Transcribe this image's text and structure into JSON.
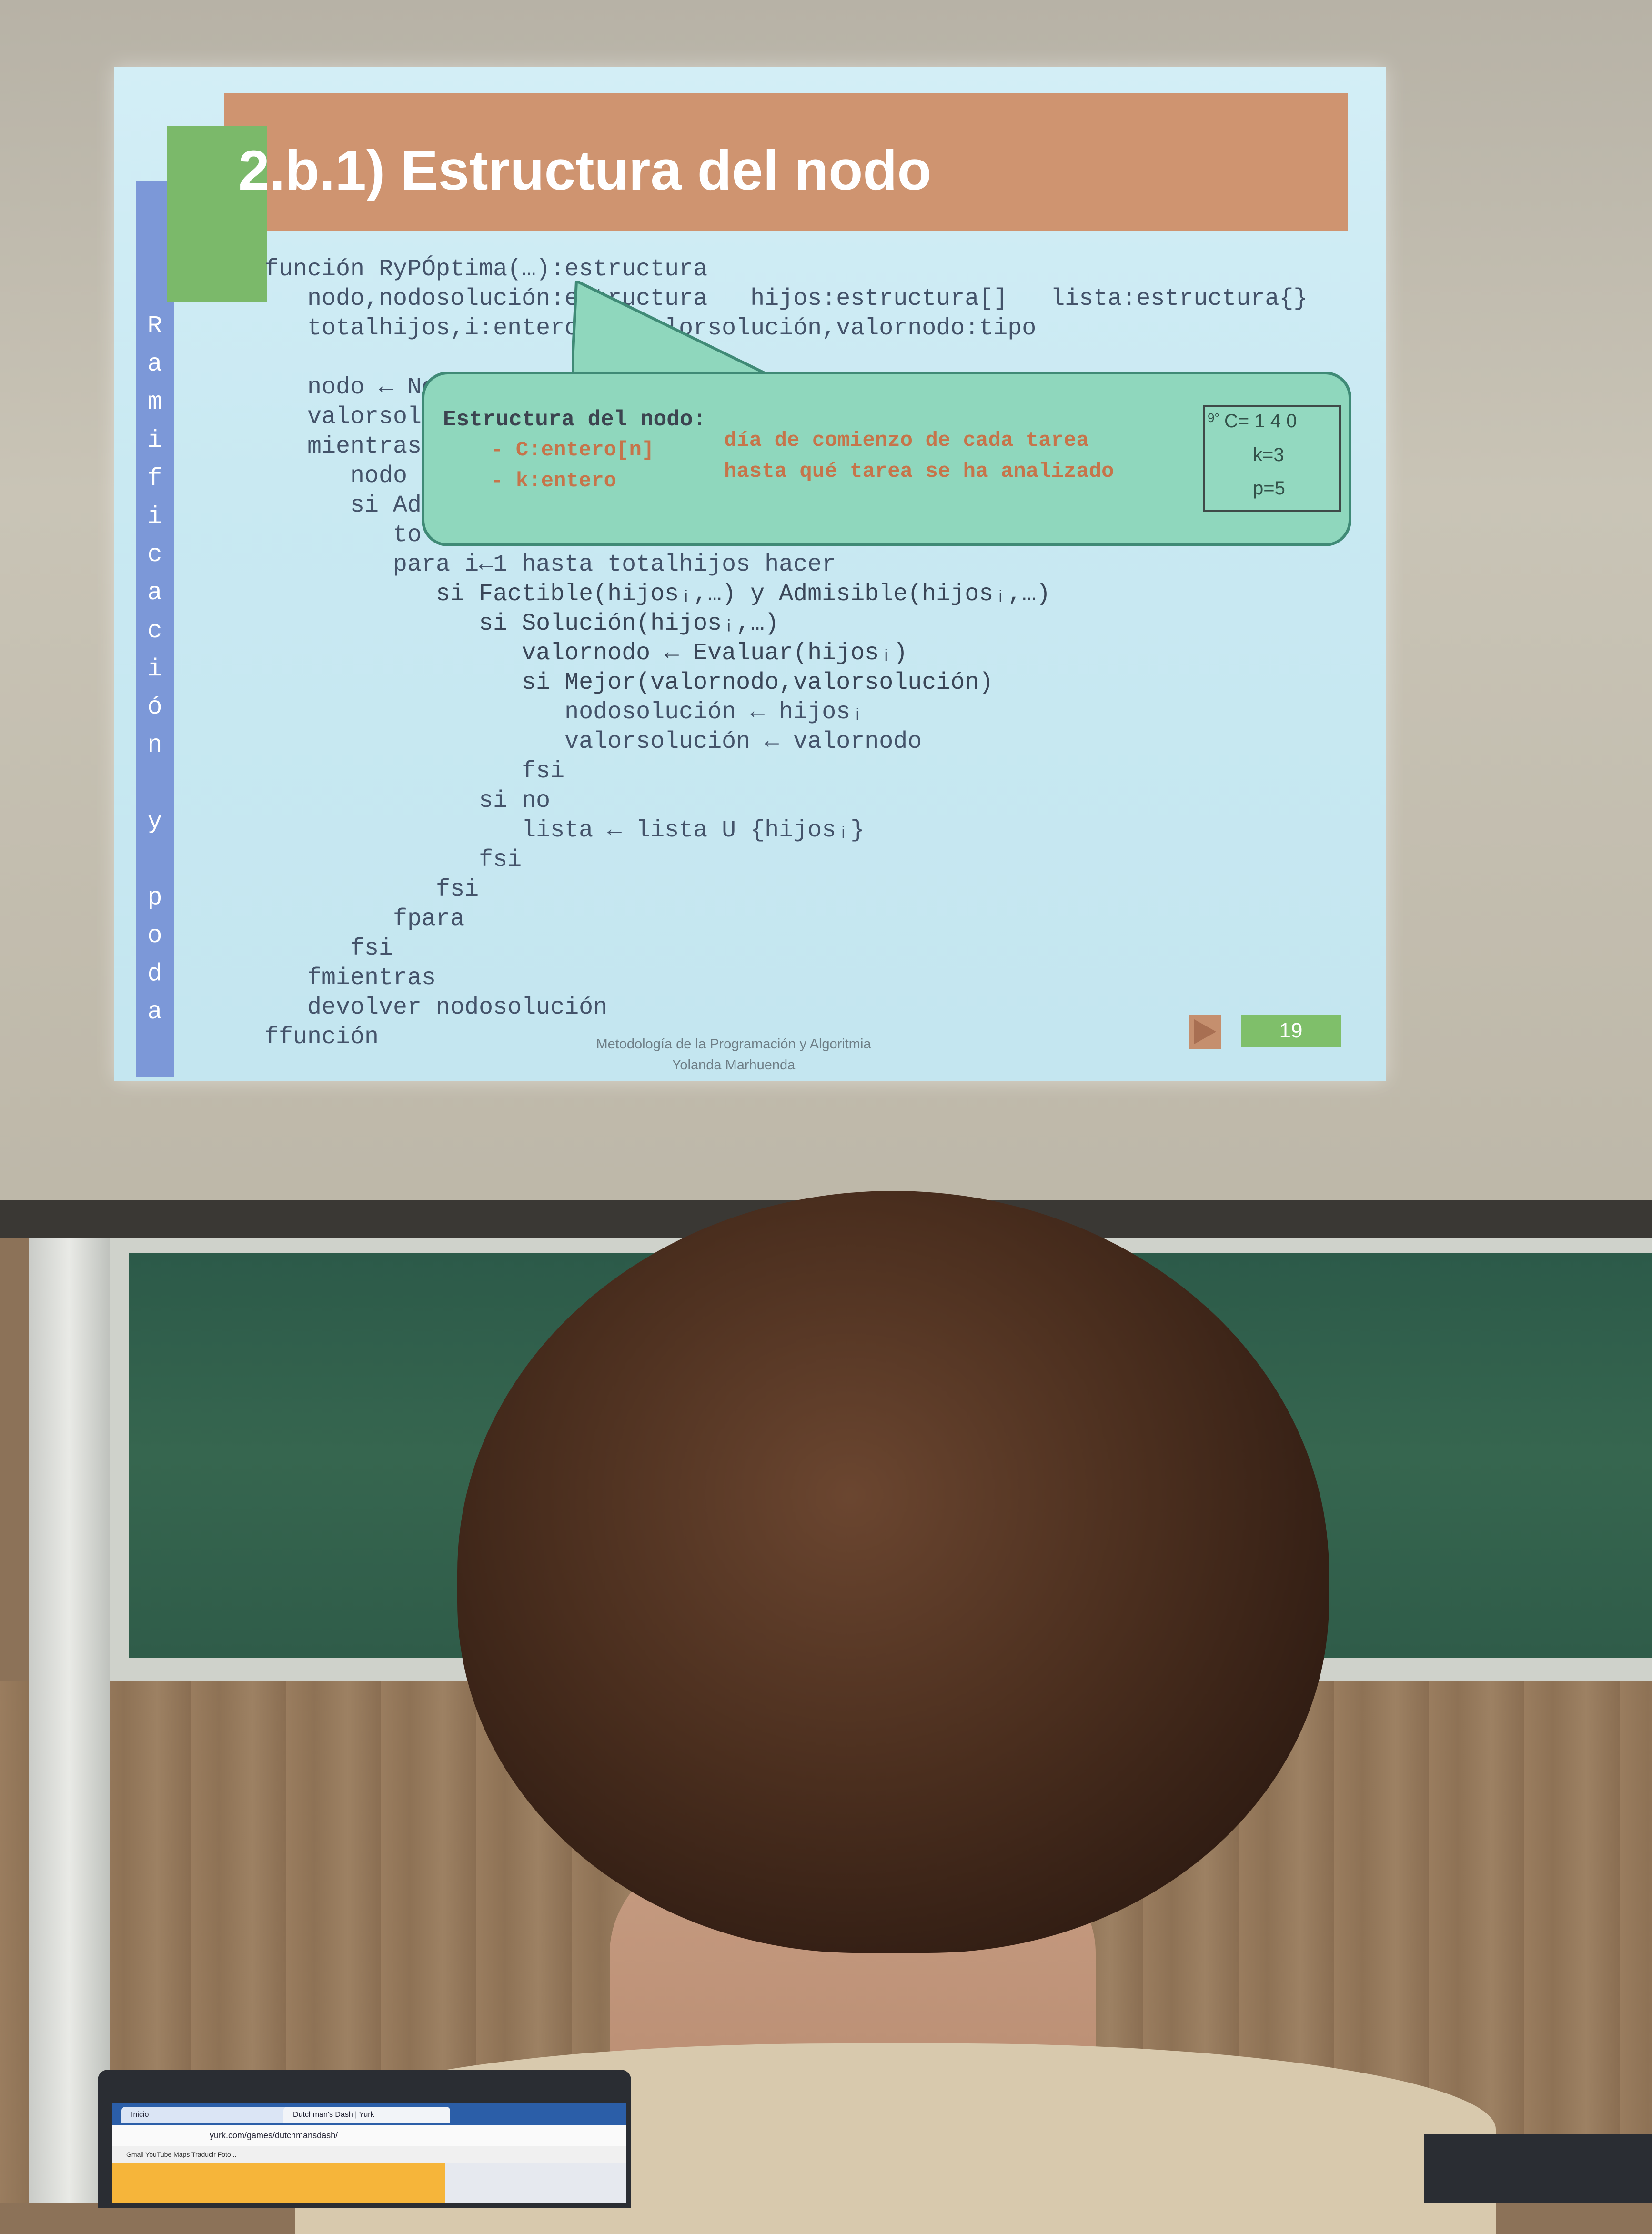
{
  "slide": {
    "title": "2.b.1) Estructura del nodo",
    "side_letters": [
      "R",
      "a",
      "m",
      "i",
      "f",
      "i",
      "c",
      "a",
      "c",
      "i",
      "ó",
      "n",
      "",
      "y",
      "",
      "p",
      "o",
      "d",
      "a"
    ],
    "code_lines": [
      "función RyPÓptima(…):estructura",
      "   nodo,nodosolución:estructura   hijos:estructura[]   lista:estructura{}",
      "   totalhijos,i:entero    valorsolución,valornodo:tipo",
      "",
      "   nodo ← NodoInicial              lista U {nodo}",
      "   valorsol",
      "   mientras",
      "      nodo",
      "      si Ad",
      "         to",
      "         para i←1 hasta totalhijos hacer",
      "            si Factible(hijosᵢ,…) y Admisible(hijosᵢ,…)",
      "               si Solución(hijosᵢ,…)",
      "                  valornodo ← Evaluar(hijosᵢ)",
      "                  si Mejor(valornodo,valorsolución)",
      "                     nodosolución ← hijosᵢ",
      "                     valorsolución ← valornodo",
      "                  fsi",
      "               si no",
      "                  lista ← lista U {hijosᵢ}",
      "               fsi",
      "            fsi",
      "         fpara",
      "      fsi",
      "   fmientras",
      "   devolver nodosolución",
      "ffunción"
    ],
    "callout": {
      "title": "Estructura del nodo:",
      "rows": [
        {
          "field": "- C:entero[n]",
          "desc": "día de comienzo de cada tarea"
        },
        {
          "field": "- k:entero",
          "desc": "hasta qué tarea se ha analizado"
        }
      ],
      "example": {
        "c_line": "C= 1 4 0",
        "c_prefix": "9°",
        "k_line": "k=3",
        "p_line": "p=5"
      }
    },
    "footer_line1": "Metodología de la Programación y Algoritmia",
    "footer_line2": "Yolanda Marhuenda",
    "page_number": "19"
  },
  "laptop": {
    "tab1": "Inicio",
    "tab2": "Dutchman's Dash | Yurk",
    "url": "yurk.com/games/dutchmansdash/",
    "bookmarks": "Gmail   YouTube   Maps   Traducir   Foto..."
  },
  "colors": {
    "slide_bg": "#c9e9f2",
    "title_bar": "#cf9470",
    "callout_bg": "#8fd7bd",
    "side_bar": "#7c98d8",
    "page_box": "#7fbf6a"
  }
}
